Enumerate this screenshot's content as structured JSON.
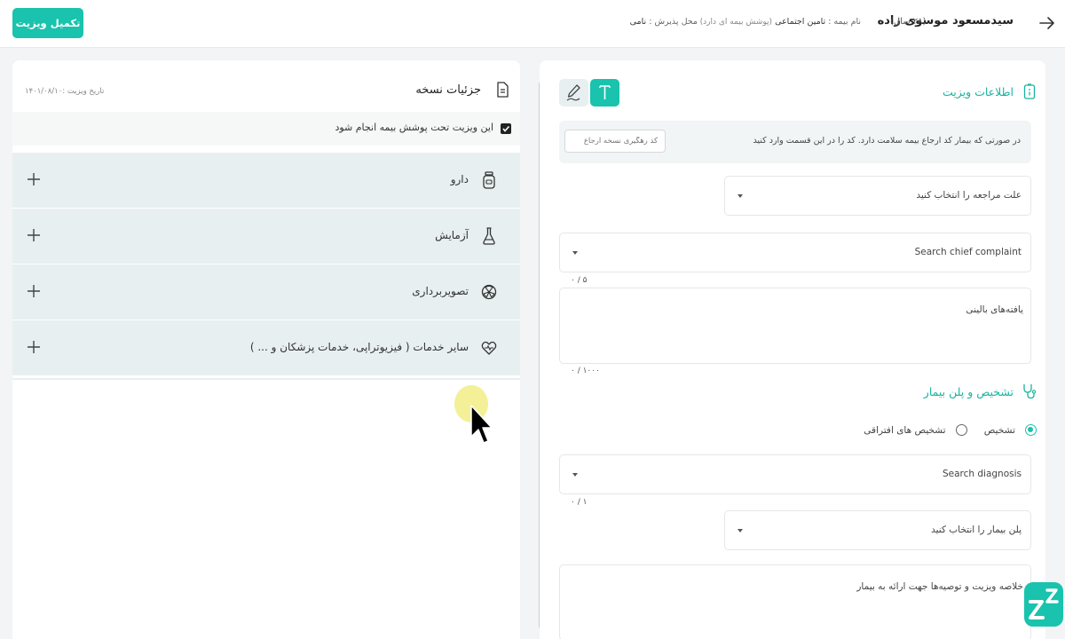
{
  "header": {
    "patient_name": "سیدمسعود موسوی زاده",
    "patient_age": "(۲۸ سال)",
    "insurance_label": "نام بیمه :",
    "insurance_name": "تامین اجتماعی",
    "insurance_coverage": "(پوشش بیمه ای دارد)",
    "location_label": "محل پذیرش :",
    "location_value": "نامی",
    "finish_button": "تکمیل ویزیت"
  },
  "prescription": {
    "title": "جزئیات نسخه",
    "visit_date": "تاریخ ویزیت :۱۴۰۱/۰۸/۱۰",
    "insurance_checkbox_label": "این ویزیت تحت پوشش بیمه انجام شود",
    "items": [
      {
        "label": "دارو",
        "icon": "medicine-bottle-icon"
      },
      {
        "label": "آزمایش",
        "icon": "flask-icon"
      },
      {
        "label": "تصویربرداری",
        "icon": "radiation-icon"
      },
      {
        "label": "سایر خدمات ( فیزیوتراپی، خدمات پزشکان و ... )",
        "icon": "heart-pulse-icon"
      }
    ]
  },
  "visit": {
    "title": "اطلاعات ویزیت",
    "referral_text": "در صورتی که بیمار کد ارجاع بیمه سلامت دارد. کد را در این قسمت وارد کنید",
    "referral_placeholder": "کد رهگیری نسخه ارجاع",
    "reason_placeholder": "علت مراجعه را انتخاب کنید",
    "chief_complaint_placeholder": "Search chief complaint",
    "chief_complaint_count": "۰ / ۵",
    "findings_placeholder": "یافته‌های بالینی",
    "findings_count": "۰ / ۱۰۰۰"
  },
  "diagnosis": {
    "title": "تشخیص و پلن بیمار",
    "radio_diagnosis": "تشخیص",
    "radio_differential": "تشخیص های افتراقی",
    "search_placeholder": "Search diagnosis",
    "count": "۰ / ۱",
    "plan_placeholder": "پلن بیمار را انتخاب کنید",
    "summary_placeholder": "خلاصه ویزیت و توصیه‌ها جهت ارائه به بیمار"
  },
  "colors": {
    "accent": "#19c3ad",
    "accent_text": "#19b3a0",
    "list_bg": "#e8eff0",
    "cursor_halo": "#f3ee8c"
  }
}
